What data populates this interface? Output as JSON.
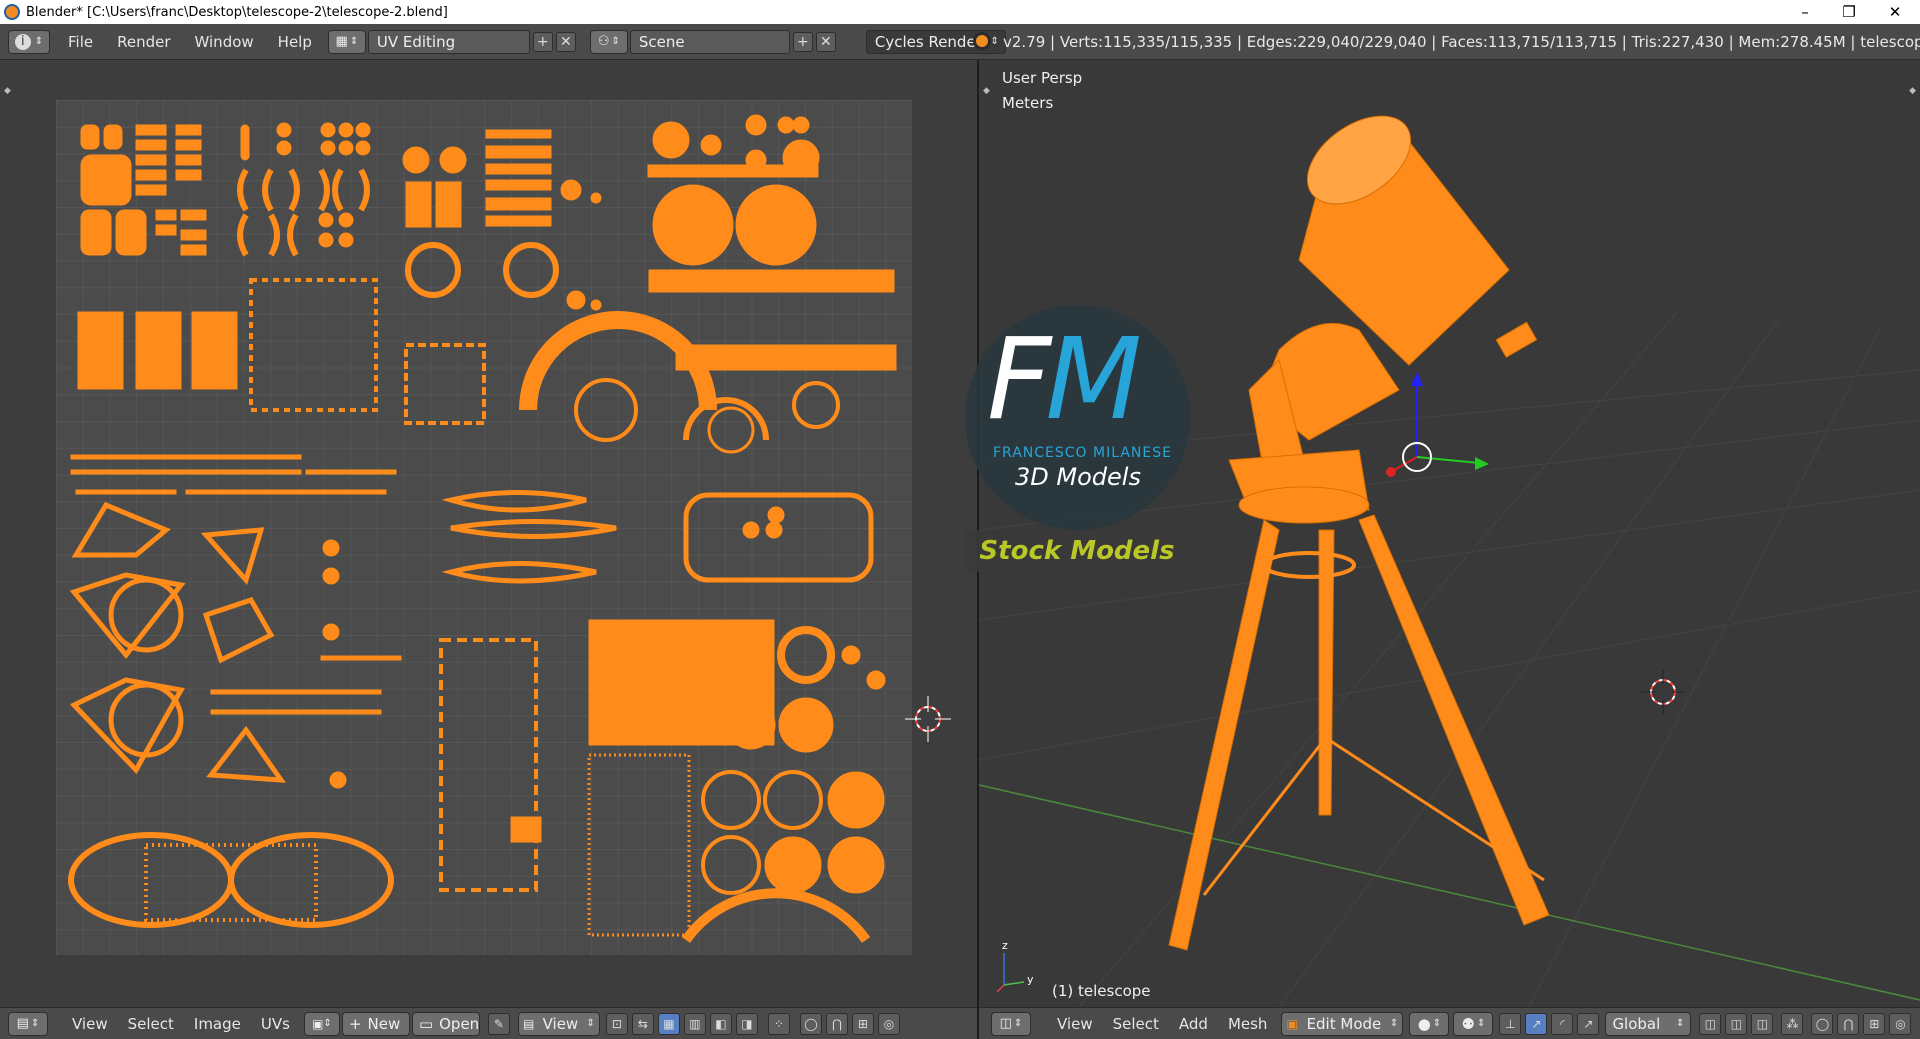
{
  "window": {
    "title": "Blender* [C:\\Users\\franc\\Desktop\\telescope-2\\telescope-2.blend]",
    "minimize": "–",
    "restore": "❐",
    "close": "✕"
  },
  "topbar": {
    "info_icon": "info-icon",
    "menus": [
      "File",
      "Render",
      "Window",
      "Help"
    ],
    "screen_layout": "UV Editing",
    "scene": "Scene",
    "render_engine": "Cycles Render",
    "status": "v2.79 | Verts:115,335/115,335 | Edges:229,040/229,040 | Faces:113,715/113,715 | Tris:227,430 | Mem:278.45M | telescope"
  },
  "uv_editor": {
    "bottom_menus": [
      "View",
      "Select",
      "Image",
      "UVs"
    ],
    "new_label": "New",
    "open_label": "Open",
    "view_label": "View"
  },
  "viewport": {
    "view_name": "User Persp",
    "units": "Meters",
    "object_label": "(1) telescope",
    "axis_z": "z",
    "axis_y": "y",
    "bottom_menus": [
      "View",
      "Select",
      "Add",
      "Mesh"
    ],
    "mode": "Edit Mode",
    "orientation": "Global"
  },
  "watermark": {
    "letters_f": "F",
    "letters_m": "M",
    "author": "FRANCESCO MILANESE",
    "subtitle": "3D Models",
    "banner": "Stock Models"
  },
  "colors": {
    "uv_orange": "#ff8c1a",
    "accent_blue": "#27a4d8",
    "stock_green": "#b9c826"
  }
}
